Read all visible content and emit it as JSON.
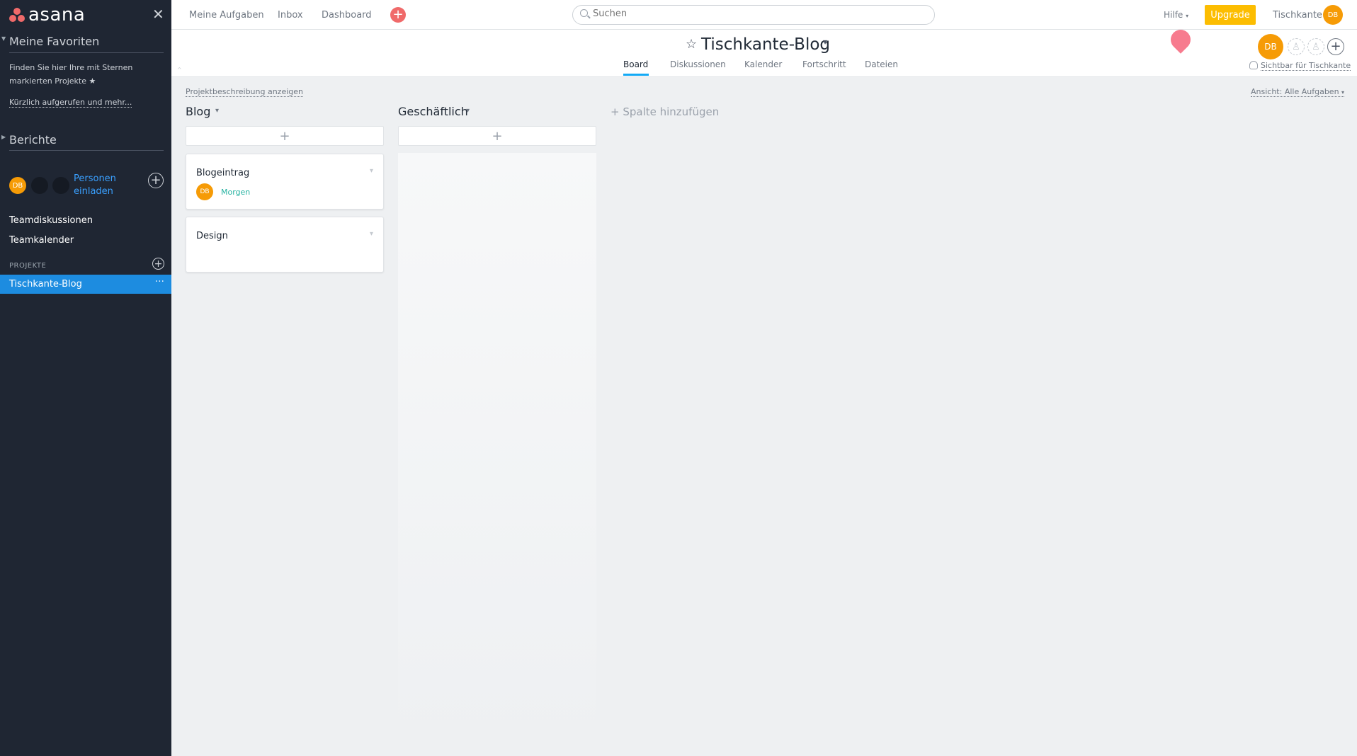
{
  "app": {
    "name": "asana"
  },
  "sidebar": {
    "favorites_title": "Meine Favoriten",
    "favorites_hint_line1": "Finden Sie hier Ihre mit Sternen",
    "favorites_hint_line2": "markierten Projekte",
    "recent_link": "Kürzlich aufgerufen und mehr...",
    "reports_title": "Berichte",
    "team_avatar_initials": "DB",
    "invite_line1": "Personen",
    "invite_line2": "einladen",
    "items": [
      {
        "label": "Teamdiskussionen"
      },
      {
        "label": "Teamkalender"
      }
    ],
    "projects_header": "PROJEKTE",
    "active_project": "Tischkante-Blog",
    "active_project_menu": "···"
  },
  "topbar": {
    "nav": [
      {
        "label": "Meine Aufgaben"
      },
      {
        "label": "Inbox"
      },
      {
        "label": "Dashboard"
      }
    ],
    "quick_add": "+",
    "search_placeholder": "Suchen",
    "help": "Hilfe",
    "upgrade": "Upgrade",
    "workspace": "Tischkante",
    "user_initials": "DB"
  },
  "project": {
    "title": "Tischkante-Blog",
    "tabs": [
      {
        "label": "Board",
        "active": true
      },
      {
        "label": "Diskussionen"
      },
      {
        "label": "Kalender"
      },
      {
        "label": "Fortschritt"
      },
      {
        "label": "Dateien"
      }
    ],
    "member_initials": "DB",
    "visibility": "Sichtbar für Tischkante",
    "description_link": "Projektbeschreibung anzeigen",
    "view_filter": "Ansicht: Alle Aufgaben"
  },
  "board": {
    "columns": [
      {
        "title": "Blog",
        "cards": [
          {
            "title": "Blogeintrag",
            "assignee": "DB",
            "due": "Morgen"
          },
          {
            "title": "Design"
          }
        ]
      },
      {
        "title": "Geschäftlich",
        "cards": []
      }
    ],
    "add_column": "+ Spalte hinzufügen",
    "add_task_symbol": "+"
  },
  "colors": {
    "sidebar_bg": "#1f2633",
    "active_item": "#1d8ce0",
    "accent_coral": "#f06a6a",
    "upgrade": "#fcbd01",
    "avatar": "#f69b06",
    "tab_underline": "#14aaf5",
    "due_soon": "#25b2a1"
  }
}
